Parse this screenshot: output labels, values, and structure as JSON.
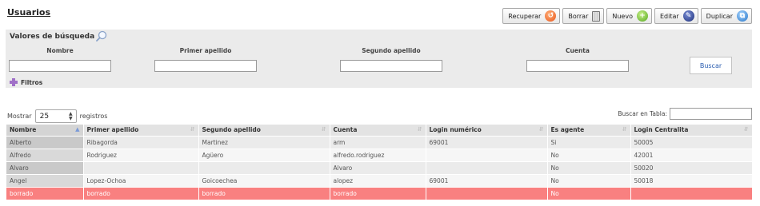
{
  "page": {
    "title": "Usuarios"
  },
  "toolbar": {
    "buttons": [
      {
        "label": "Recuperar",
        "icon": "recover-icon"
      },
      {
        "label": "Borrar",
        "icon": "trash-icon"
      },
      {
        "label": "Nuevo",
        "icon": "add-icon"
      },
      {
        "label": "Editar",
        "icon": "edit-icon"
      },
      {
        "label": "Duplicar",
        "icon": "duplicate-icon"
      }
    ]
  },
  "search": {
    "title": "Valores de búsqueda",
    "fields": [
      {
        "label": "Nombre",
        "value": ""
      },
      {
        "label": "Primer apellido",
        "value": ""
      },
      {
        "label": "Segundo apellido",
        "value": ""
      },
      {
        "label": "Cuenta",
        "value": ""
      }
    ],
    "submit_label": "Buscar",
    "filters_label": "Filtros"
  },
  "list": {
    "show_prefix": "Mostrar",
    "page_length": "25",
    "show_suffix": "registros",
    "table_search_label": "Buscar en Tabla:",
    "table_search_value": ""
  },
  "table": {
    "columns": [
      "Nombre",
      "Primer apellido",
      "Segundo apellido",
      "Cuenta",
      "Login numérico",
      "Es agente",
      "Login Centralita"
    ],
    "sorted_column": "Nombre",
    "rows": [
      [
        "Alberto",
        "Ribagorda",
        "Martinez",
        "arm",
        "69001",
        "Si",
        "50005"
      ],
      [
        "Alfredo",
        "Rodriguez",
        "Agüero",
        "alfredo.rodriguez",
        "",
        "No",
        "42001"
      ],
      [
        "Alvaro",
        "",
        "",
        "Alvaro",
        "",
        "No",
        "50020"
      ],
      [
        "Angel",
        "Lopez-Ochoa",
        "Goicoechea",
        "alopez",
        "69001",
        "No",
        "50018"
      ],
      [
        "borrado",
        "borrado",
        "borrado",
        "borrado",
        "",
        "No",
        ""
      ]
    ],
    "deleted_row_color": "#f98080"
  },
  "colors": {
    "link": "#2a5db0",
    "panel": "#ebebeb"
  }
}
